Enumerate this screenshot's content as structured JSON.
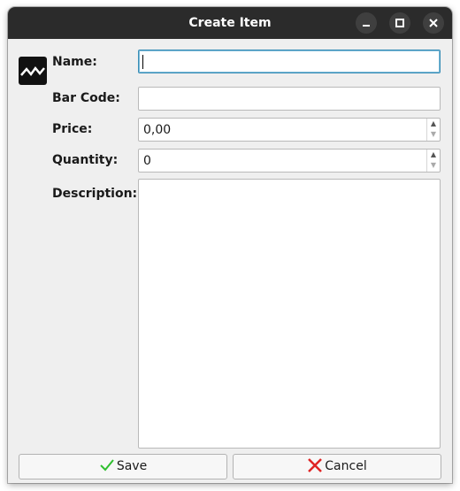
{
  "window": {
    "title": "Create Item",
    "controls": {
      "minimize_icon": "minimize-icon",
      "maximize_icon": "maximize-icon",
      "close_icon": "close-icon"
    }
  },
  "form": {
    "app_icon": "waveform-icon",
    "name": {
      "label": "Name:",
      "value": ""
    },
    "barcode": {
      "label": "Bar Code:",
      "value": ""
    },
    "price": {
      "label": "Price:",
      "value": "0,00"
    },
    "quantity": {
      "label": "Quantity:",
      "value": "0"
    },
    "description": {
      "label": "Description:",
      "value": ""
    }
  },
  "buttons": {
    "save": {
      "label": "Save",
      "icon": "checkmark-icon",
      "icon_color": "#2fbf2f"
    },
    "cancel": {
      "label": "Cancel",
      "icon": "cross-icon",
      "icon_color": "#e02424"
    }
  },
  "colors": {
    "titlebar": "#2b2b2b",
    "window_bg": "#efefef",
    "focus": "#3a8fb7"
  }
}
